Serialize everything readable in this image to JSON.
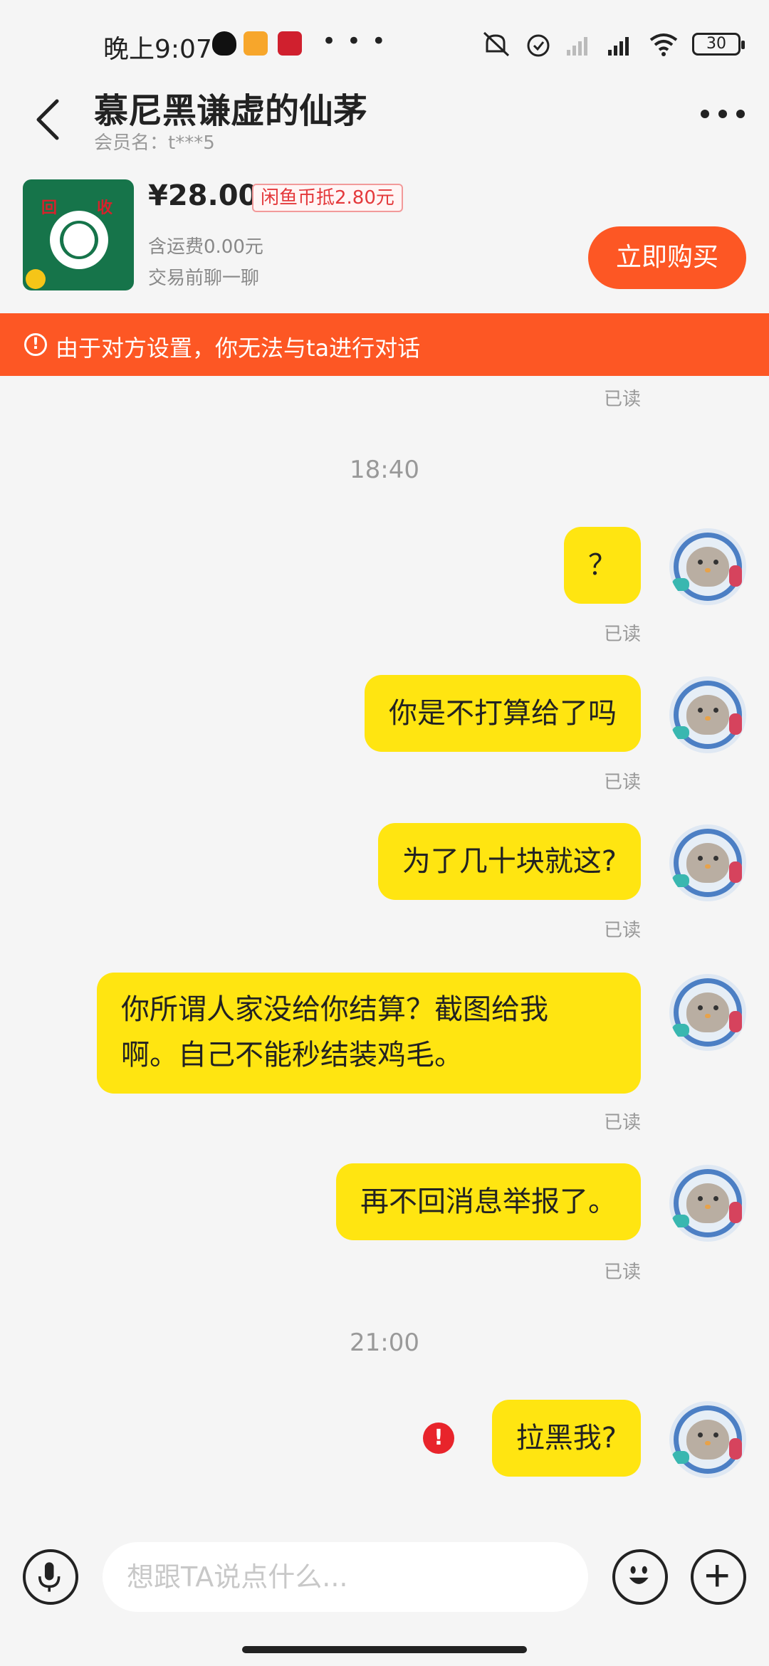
{
  "status_bar": {
    "time": "晚上9:07",
    "battery": "30"
  },
  "header": {
    "title": "慕尼黑谦虚的仙茅",
    "member_label": "会员名：t***5"
  },
  "product": {
    "thumb_text_top_left": "回",
    "thumb_text_top_right": "收",
    "price": "¥28.00",
    "coin_discount": "闲鱼币抵2.80元",
    "shipping": "含运费0.00元",
    "chat_prompt": "交易前聊一聊",
    "buy_label": "立即购买"
  },
  "banner": {
    "icon": "!",
    "text": "由于对方设置，你无法与ta进行对话"
  },
  "messages": {
    "read_label": "已读",
    "time_1": "18:40",
    "time_2": "21:00",
    "m1": "？",
    "m2": "你是不打算给了吗",
    "m3": "为了几十块就这?",
    "m4_line1": "你所谓人家没给你结算？截图给我",
    "m4_line2": "啊。自己不能秒结装鸡毛。",
    "m5": "再不回消息举报了。",
    "m6": "拉黑我?",
    "error_icon": "!"
  },
  "input_bar": {
    "placeholder": "想跟TA说点什么..."
  },
  "colors": {
    "accent": "#fd5724",
    "bubble": "#ffe511",
    "error": "#e8242b"
  }
}
